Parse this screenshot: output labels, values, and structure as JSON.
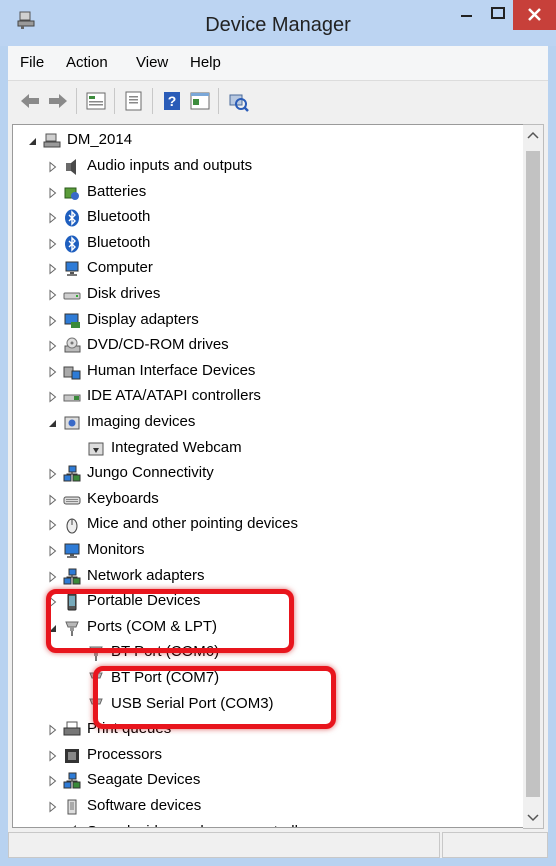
{
  "window": {
    "title": "Device Manager",
    "minimize_glyph": "–",
    "maximize_glyph": "□",
    "close_glyph": "✕"
  },
  "menu": [
    "File",
    "Action",
    "View",
    "Help"
  ],
  "toolbar": {
    "buttons": [
      "back-arrow-icon",
      "forward-arrow-icon",
      "properties-icon",
      "scan-icon",
      "help-icon",
      "view-icon",
      "update-driver-icon"
    ]
  },
  "tree": {
    "root": "DM_2014",
    "items": [
      {
        "label": "Audio inputs and outputs",
        "icon": "speaker-icon",
        "state": "collapsed"
      },
      {
        "label": "Batteries",
        "icon": "battery-icon",
        "state": "collapsed"
      },
      {
        "label": "Bluetooth",
        "icon": "bluetooth-icon",
        "state": "collapsed"
      },
      {
        "label": "Bluetooth",
        "icon": "bluetooth-icon",
        "state": "collapsed"
      },
      {
        "label": "Computer",
        "icon": "computer-icon",
        "state": "collapsed"
      },
      {
        "label": "Disk drives",
        "icon": "disk-drive-icon",
        "state": "collapsed"
      },
      {
        "label": "Display adapters",
        "icon": "display-adapter-icon",
        "state": "collapsed"
      },
      {
        "label": "DVD/CD-ROM drives",
        "icon": "dvd-drive-icon",
        "state": "collapsed"
      },
      {
        "label": "Human Interface Devices",
        "icon": "hid-icon",
        "state": "collapsed"
      },
      {
        "label": "IDE ATA/ATAPI controllers",
        "icon": "ide-controller-icon",
        "state": "collapsed"
      },
      {
        "label": "Imaging devices",
        "icon": "camera-icon",
        "state": "expanded"
      },
      {
        "label": "Integrated Webcam",
        "icon": "webcam-icon",
        "state": "child"
      },
      {
        "label": "Jungo Connectivity",
        "icon": "network-icon",
        "state": "collapsed"
      },
      {
        "label": "Keyboards",
        "icon": "keyboard-icon",
        "state": "collapsed"
      },
      {
        "label": "Mice and other pointing devices",
        "icon": "mouse-icon",
        "state": "collapsed"
      },
      {
        "label": "Monitors",
        "icon": "monitor-icon",
        "state": "collapsed"
      },
      {
        "label": "Network adapters",
        "icon": "network-icon",
        "state": "collapsed"
      },
      {
        "label": "Portable Devices",
        "icon": "portable-device-icon",
        "state": "collapsed"
      },
      {
        "label": "Ports (COM & LPT)",
        "icon": "port-icon",
        "state": "expanded"
      },
      {
        "label": "BT Port (COM6)",
        "icon": "port-icon",
        "state": "child"
      },
      {
        "label": "BT Port (COM7)",
        "icon": "port-icon",
        "state": "child"
      },
      {
        "label": "USB Serial Port (COM3)",
        "icon": "port-icon",
        "state": "child"
      },
      {
        "label": "Print queues",
        "icon": "printer-icon",
        "state": "collapsed"
      },
      {
        "label": "Processors",
        "icon": "processor-icon",
        "state": "collapsed"
      },
      {
        "label": "Seagate Devices",
        "icon": "network-icon",
        "state": "collapsed"
      },
      {
        "label": "Software devices",
        "icon": "software-device-icon",
        "state": "collapsed"
      },
      {
        "label": "Sound, video and game controllers",
        "icon": "speaker-icon",
        "state": "collapsed"
      }
    ]
  },
  "annotations": {
    "highlight_color": "#e8151d"
  },
  "colors": {
    "titlebar": "#bcd4f2",
    "close": "#c7403a"
  }
}
